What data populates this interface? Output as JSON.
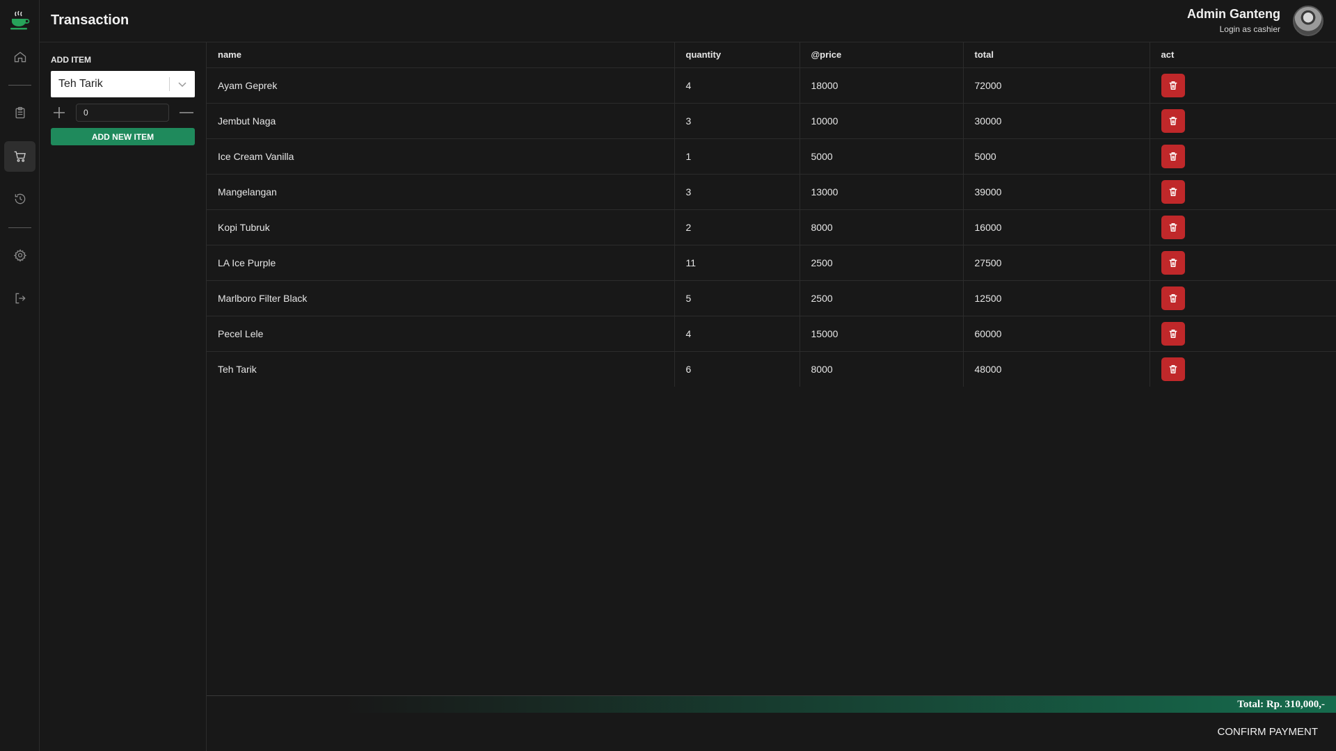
{
  "header": {
    "title": "Transaction",
    "user_name": "Admin Ganteng",
    "user_role": "Login as cashier"
  },
  "nav": {
    "items": [
      {
        "icon": "home-icon"
      },
      {
        "icon": "clipboard-icon"
      },
      {
        "icon": "cart-icon",
        "active": true
      },
      {
        "icon": "history-icon"
      },
      {
        "icon": "gear-icon"
      },
      {
        "icon": "logout-icon"
      }
    ]
  },
  "add_item": {
    "label": "ADD ITEM",
    "selected_item": "Teh Tarik",
    "quantity": "0",
    "button_label": "ADD NEW ITEM"
  },
  "table": {
    "headers": [
      "name",
      "quantity",
      "@price",
      "total",
      "act"
    ],
    "rows": [
      {
        "name": "Ayam Geprek",
        "quantity": "4",
        "price": "18000",
        "total": "72000"
      },
      {
        "name": "Jembut Naga",
        "quantity": "3",
        "price": "10000",
        "total": "30000"
      },
      {
        "name": "Ice Cream Vanilla",
        "quantity": "1",
        "price": "5000",
        "total": "5000"
      },
      {
        "name": "Mangelangan",
        "quantity": "3",
        "price": "13000",
        "total": "39000"
      },
      {
        "name": "Kopi Tubruk",
        "quantity": "2",
        "price": "8000",
        "total": "16000"
      },
      {
        "name": "LA Ice Purple",
        "quantity": "11",
        "price": "2500",
        "total": "27500"
      },
      {
        "name": "Marlboro Filter Black",
        "quantity": "5",
        "price": "2500",
        "total": "12500"
      },
      {
        "name": "Pecel Lele",
        "quantity": "4",
        "price": "15000",
        "total": "60000"
      },
      {
        "name": "Teh Tarik",
        "quantity": "6",
        "price": "8000",
        "total": "48000"
      }
    ]
  },
  "footer": {
    "total_text": "Total: Rp. 310,000,-",
    "confirm_label": "CONFIRM PAYMENT"
  },
  "colors": {
    "accent": "#1f8a5c",
    "danger": "#c0282a",
    "background": "#181818"
  }
}
